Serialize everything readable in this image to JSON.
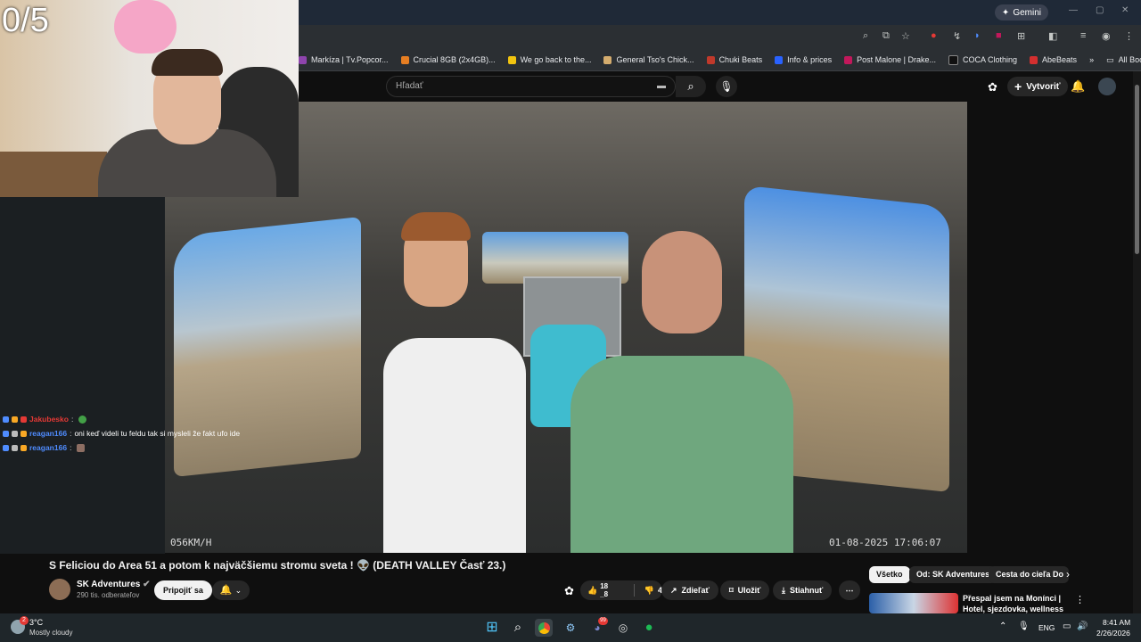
{
  "browser": {
    "gemini_label": "Gemini",
    "bookmarks": [
      {
        "label": "Markíza | Tv.Popcor...",
        "color": "#8e44ad"
      },
      {
        "label": "Crucial 8GB (2x4GB)...",
        "color": "#e67e22"
      },
      {
        "label": "We go back to the...",
        "color": "#f1c40f"
      },
      {
        "label": "General Tso's Chick...",
        "color": "#d4ac6e"
      },
      {
        "label": "Chuki Beats",
        "color": "#c0392b"
      },
      {
        "label": "Info & prices",
        "color": "#2962ff"
      },
      {
        "label": "Post Malone | Drake...",
        "color": "#c2185b"
      },
      {
        "label": "COCA Clothing",
        "color": "#111111"
      },
      {
        "label": "AbeBeats",
        "color": "#d32f2f"
      }
    ],
    "all_bookmarks_label": "All Bookmarks"
  },
  "youtube": {
    "search_placeholder": "Hľadať",
    "create_label": "Vytvoriť"
  },
  "video": {
    "speed_overlay": "056KM/H",
    "timestamp_overlay": "01-08-2025  17:06:07",
    "title": "S Feliciou do Area 51 a potom k najväčšiemu stromu sveta ! 👽 (DEATH VALLEY Časť 23.)",
    "channel_name": "SK Adventures",
    "subscribers": "290 tis. odberateľov",
    "join_label": "Pripojiť sa",
    "likes": "18",
    "likes_sub": "_8",
    "dislikes": "4",
    "share_label": "Zdieľať",
    "save_label": "Uložiť",
    "download_label": "Stiahnuť"
  },
  "filter_chips": [
    "Všetko",
    "Od: SK Adventures",
    "Cesta do cieľa Do"
  ],
  "recommendation": {
    "title": "Přespal jsem na Monínci | Hotel, sjezdovka, wellness"
  },
  "stream": {
    "counter": "0/5",
    "chat": [
      {
        "user": "Jakubesko",
        "user_color": "#e53935",
        "message": ""
      },
      {
        "user": "reagan166",
        "user_color": "#4f8cff",
        "message": "oni keď videli tu feldu tak si mysleli že fakt ufo ide"
      },
      {
        "user": "reagan166",
        "user_color": "#4f8cff",
        "message": ""
      }
    ]
  },
  "taskbar": {
    "weather_badge": "2",
    "temperature": "3°C",
    "weather": "Mostly cloudy",
    "language": "ENG",
    "time": "8:41 AM",
    "date": "2/26/2026",
    "discord_badge": "99"
  }
}
